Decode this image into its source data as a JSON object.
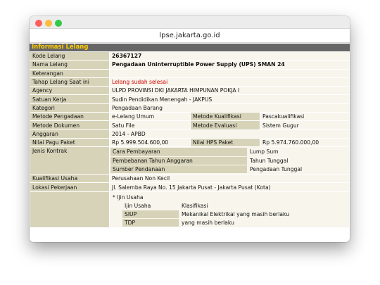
{
  "window": {
    "url": "lpse.jakarta.go.id"
  },
  "section": {
    "title": "Informasi Lelang"
  },
  "fields": {
    "kode_lelang": {
      "label": "Kode Lelang",
      "value": "26367127"
    },
    "nama_lelang": {
      "label": "Nama Lelang",
      "value": "Pengadaan Uninterruptible Power Supply (UPS) SMAN 24"
    },
    "keterangan": {
      "label": "Keterangan",
      "value": ""
    },
    "tahap": {
      "label": "Tahap Lelang Saat ini",
      "value": "Lelang sudah selesai"
    },
    "agency": {
      "label": "Agency",
      "value": "ULPD PROVINSI DKI JAKARTA HIMPUNAN POKJA I"
    },
    "satuan_kerja": {
      "label": "Satuan Kerja",
      "value": "Sudin Pendidikan Menengah - JAKPUS"
    },
    "kategori": {
      "label": "Kategori",
      "value": "Pengadaan Barang"
    },
    "metode_pengadaan": {
      "label": "Metode Pengadaan",
      "value": "e-Lelang Umum"
    },
    "metode_kualifikasi": {
      "label": "Metode Kualifikasi",
      "value": "Pascakualifikasi"
    },
    "metode_dokumen": {
      "label": "Metode Dokumen",
      "value": "Satu File"
    },
    "metode_evaluasi": {
      "label": "Metode Evaluasi",
      "value": "Sistem Gugur"
    },
    "anggaran": {
      "label": "Anggaran",
      "value": "2014 - APBD"
    },
    "pagu": {
      "label": "Nilai Pagu Paket",
      "value": "Rp 5.999.504.600,00"
    },
    "hps": {
      "label": "Nilai HPS Paket",
      "value": "Rp 5.974.760.000,00"
    },
    "jenis_kontrak": {
      "label": "Jenis Kontrak",
      "rows": [
        {
          "label": "Cara Pembayaran",
          "value": "Lump Sum"
        },
        {
          "label": "Pembebanan Tahun Anggaran",
          "value": "Tahun Tunggal"
        },
        {
          "label": "Sumber Pendanaan",
          "value": "Pengadaan Tunggal"
        }
      ]
    },
    "kualifikasi_usaha": {
      "label": "Kualifikasi Usaha",
      "value": "Perusahaan Non Kecil"
    },
    "lokasi": {
      "label": "Lokasi Pekerjaan",
      "value": "Jl. Salemba Raya No. 15 Jakarta Pusat - Jakarta Pusat (Kota)"
    }
  },
  "ijin_usaha": {
    "title": "* Ijin Usaha",
    "header": {
      "col1": "Ijin Usaha",
      "col2": "Klasifikasi"
    },
    "rows": [
      {
        "ijin": "SIUP",
        "klasifikasi": "Mekanikal Elektrikal yang masih berlaku"
      },
      {
        "ijin": "TDP",
        "klasifikasi": "yang masih berlaku"
      }
    ]
  }
}
